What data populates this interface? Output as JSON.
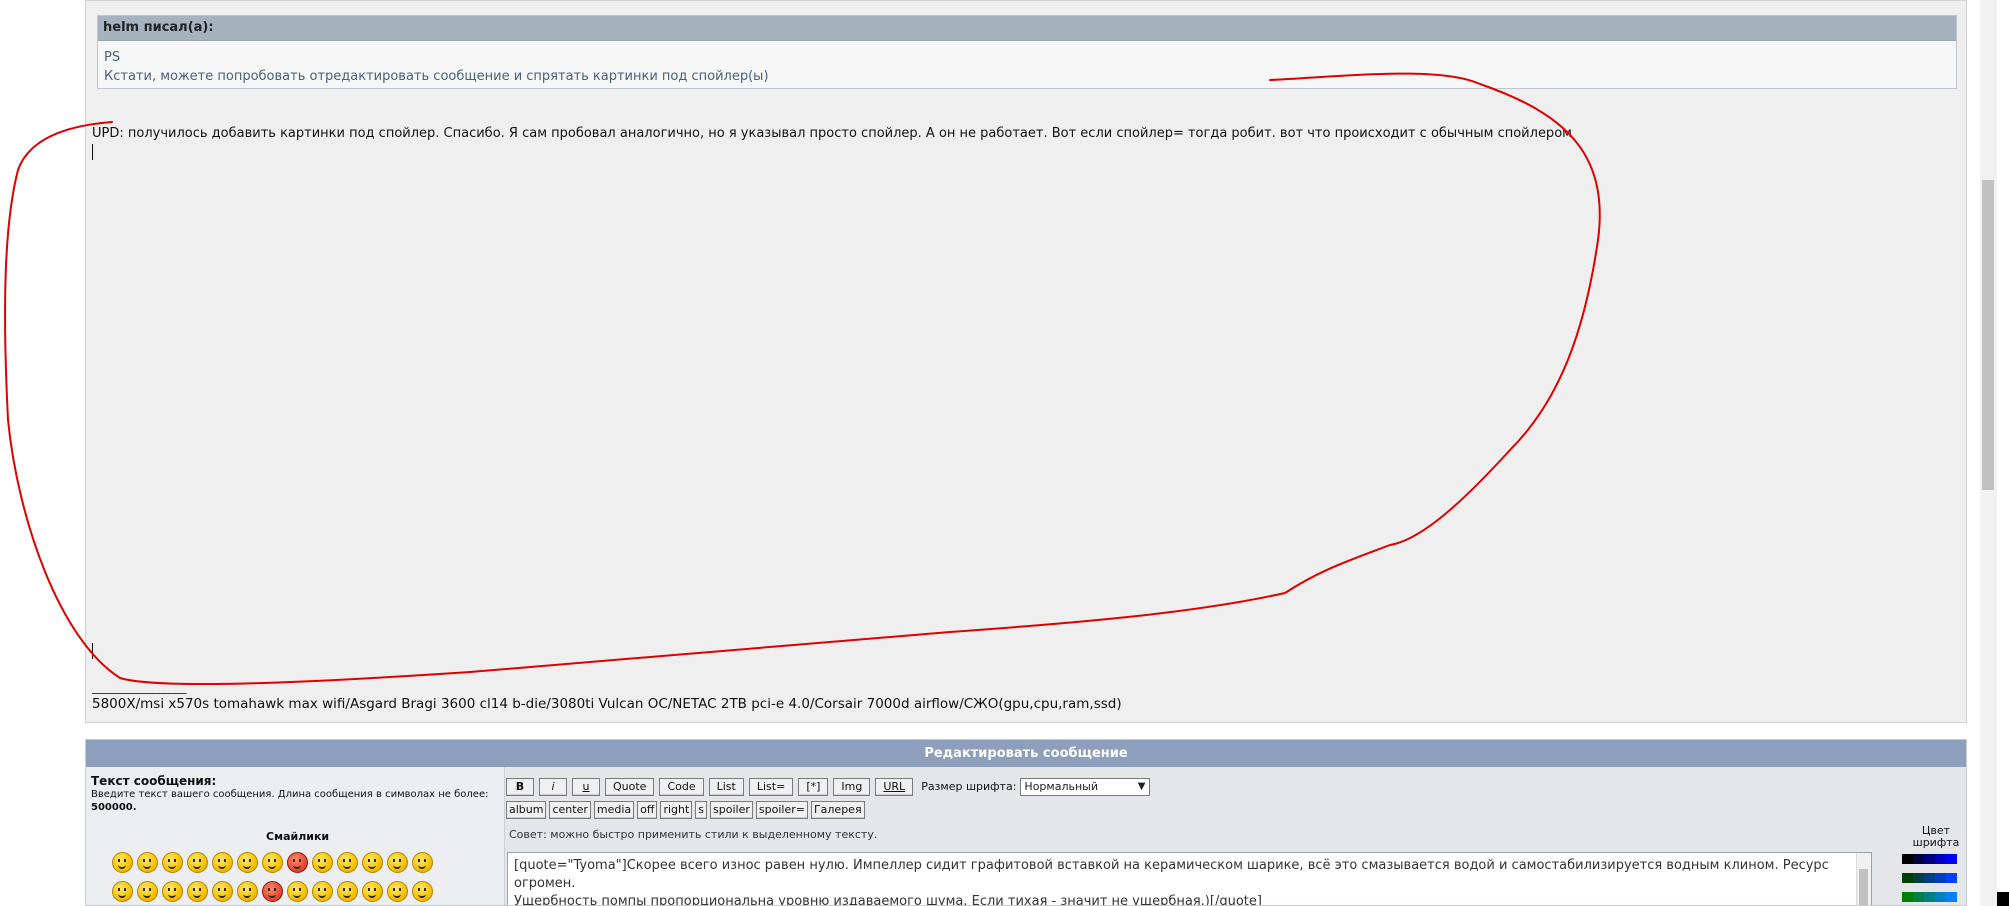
{
  "quote": {
    "author_header": "helm писал(а):",
    "lines": [
      "PS",
      "Кстати, можете попробовать отредактировать сообщение и спрятать картинки под спойлер(ы)"
    ]
  },
  "post": {
    "upd_text": "UPD: получилось добавить картинки под спойлер. Спасибо. Я сам пробовал аналогично, но я указывал просто спойлер. А он не работает. Вот если спойлер= тогда робит. вот что происходит с обычным спойлером",
    "signature_separator": "_________________",
    "signature": "5800X/msi x570s tomahawk max wifi/Asgard Bragi 3600 cl14 b-die/3080ti Vulcan OC/NETAC 2TB pci-e 4.0/Corsair 7000d airflow/СЖО(gpu,cpu,ram,ssd)"
  },
  "editor": {
    "header": "Редактировать сообщение",
    "label_title": "Текст сообщения:",
    "label_hint": "Введите текст вашего сообщения. Длина сообщения в символах не более:",
    "max_length": "500000.",
    "smilies_title": "Смайлики",
    "toolbar_row1": [
      "B",
      "i",
      "u",
      "Quote",
      "Code",
      "List",
      "List=",
      "[*]",
      "Img",
      "URL"
    ],
    "font_size_label": "Размер шрифта:",
    "font_size_value": "Нормальный",
    "toolbar_row2": [
      "album",
      "center",
      "media",
      "off",
      "right",
      "s",
      "spoiler",
      "spoiler=",
      "Галерея"
    ],
    "tip": "Совет: можно быстро применить стили к выделенному тексту.",
    "textarea_value": "[quote=\"Tyoma\"]Скорее всего износ равен нулю. Импеллер сидит графитовой вставкой на керамическом шарике, всё это смазывается водой и самостабилизируется водным клином. Ресурс огромен.\nУщербность помпы пропорциональна уровню издаваемого шума. Если тихая - значит не ущербная.)[/quote]",
    "color_title": "Цвет шрифта"
  },
  "colors": {
    "annotation": "#e00000",
    "edit_header_bg": "#8d9fbd",
    "quote_header_bg": "#a6b3bf",
    "palette": [
      "#000000",
      "#000040",
      "#000080",
      "#0000bf",
      "#0000ff",
      "#004000",
      "#004040",
      "#004080",
      "#0040bf",
      "#0040ff",
      "#008000",
      "#008040",
      "#008080",
      "#0080bf",
      "#0080ff",
      "#00bf00",
      "#00bf40",
      "#00bf80",
      "#00bfbf",
      "#00bfff",
      "#00ff00",
      "#00ff40",
      "#00ff80",
      "#00ffbf",
      "#00ffff"
    ]
  }
}
